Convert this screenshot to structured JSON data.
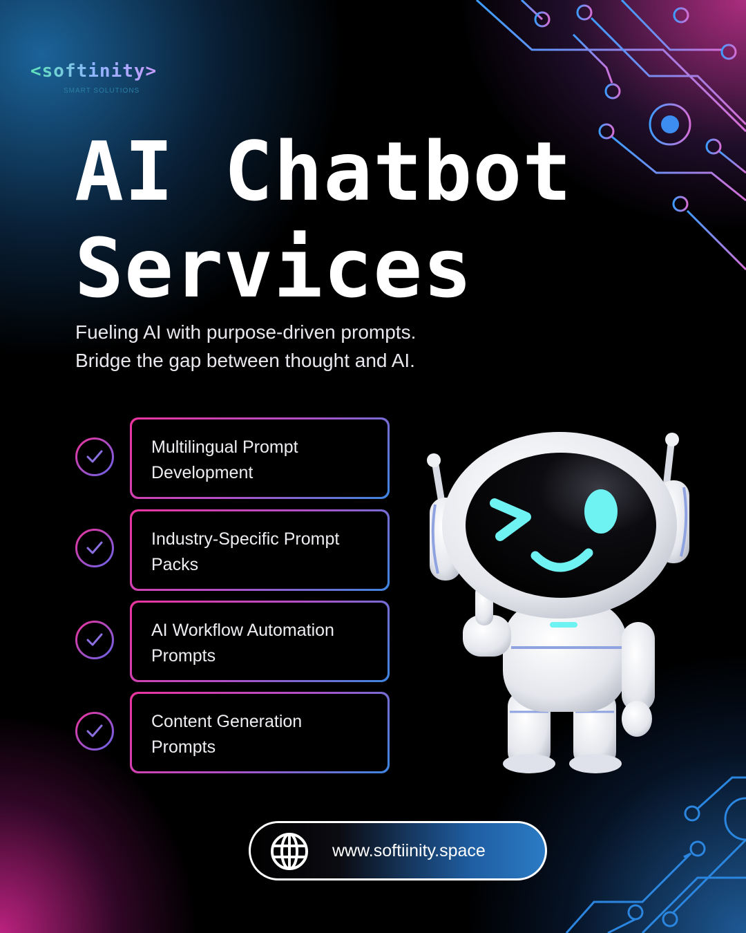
{
  "brand": {
    "logo_text": "<softinity>",
    "tagline": "SMART SOLUTIONS"
  },
  "hero": {
    "title_line1": "AI Chatbot",
    "title_line2": "Services",
    "subtitle_line1": "Fueling AI with purpose-driven prompts.",
    "subtitle_line2": "Bridge the gap between thought and AI."
  },
  "services": [
    {
      "line1": "Multilingual Prompt",
      "line2": "Development"
    },
    {
      "line1": "Industry-Specific Prompt",
      "line2": "Packs"
    },
    {
      "line1": "AI Workflow Automation",
      "line2": "Prompts"
    },
    {
      "line1": "Content Generation",
      "line2": "Prompts"
    }
  ],
  "footer": {
    "website": "www.softiinity.space",
    "icon": "globe-icon"
  },
  "colors": {
    "background": "#000000",
    "accent_pink": "#e9349c",
    "accent_blue": "#3d86e0",
    "robot_eyes": "#6ff2f2"
  }
}
